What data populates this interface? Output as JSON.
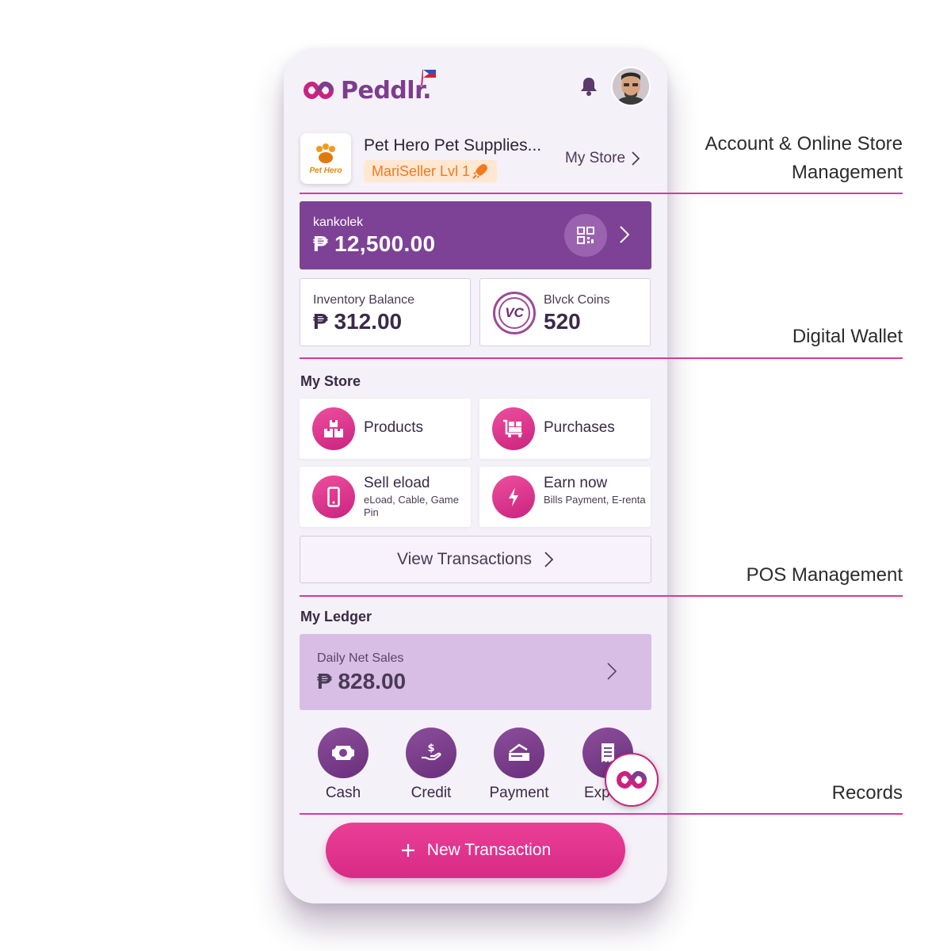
{
  "app": {
    "brand": "Peddlr.",
    "store_name": "Pet Hero Pet Supplies...",
    "store_logo_text": "Pet Hero",
    "seller_badge": "MariSeller Lvl 1",
    "my_store_link": "My Store"
  },
  "wallet": {
    "label": "kankolek",
    "amount": "₱ 12,500.00"
  },
  "inventory": {
    "label": "Inventory Balance",
    "value": "₱ 312.00"
  },
  "coins": {
    "label": "Blvck Coins",
    "value": "520",
    "badge": "VC"
  },
  "my_store": {
    "title": "My Store",
    "tiles": [
      {
        "label": "Products",
        "icon": "boxes-icon"
      },
      {
        "label": "Purchases",
        "icon": "cart-icon"
      },
      {
        "label": "Sell eload",
        "sub": "eLoad, Cable, Game Pin",
        "icon": "phone-icon"
      },
      {
        "label": "Earn now",
        "sub": "Bills Payment, E-renta",
        "icon": "bolt-icon"
      }
    ],
    "view_transactions": "View Transactions"
  },
  "ledger": {
    "title": "My Ledger",
    "label": "Daily Net Sales",
    "amount": "₱ 828.00",
    "records": [
      {
        "label": "Cash",
        "icon": "cash-icon"
      },
      {
        "label": "Credit",
        "icon": "credit-icon"
      },
      {
        "label": "Payment",
        "icon": "payment-icon"
      },
      {
        "label": "Expenses",
        "icon": "receipt-icon"
      }
    ]
  },
  "new_transaction": "New Transaction",
  "annotations": {
    "account_line1": "Account & Online Store",
    "account_line2": "Management",
    "wallet": "Digital Wallet",
    "pos": "POS Management",
    "records": "Records"
  },
  "colors": {
    "brand_purple": "#7d4196",
    "accent_pink": "#d72a86",
    "ledger_bg": "#d8bde5",
    "badge_orange": "#f07a1e"
  }
}
